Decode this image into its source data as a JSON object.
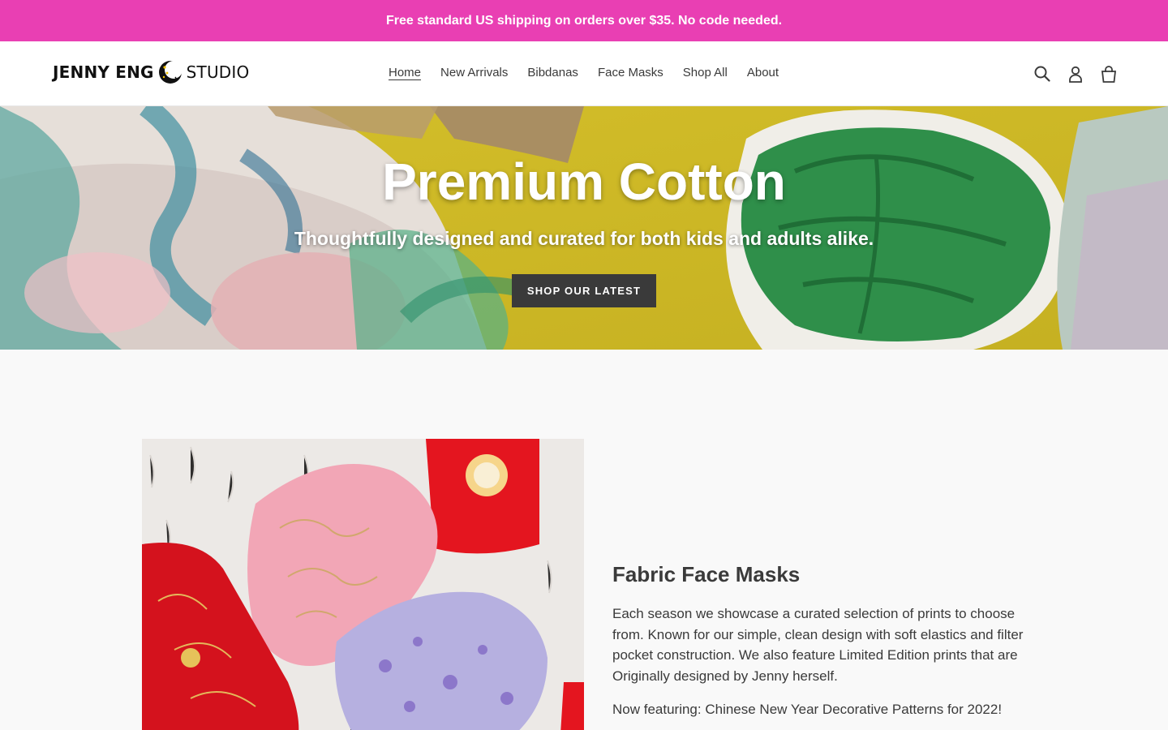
{
  "announcement": {
    "text": "Free standard US shipping on orders over $35. No code needed.",
    "bg_color": "#e93fb3"
  },
  "header": {
    "logo": {
      "part1": "JENNY ENG",
      "part2": "STUDIO",
      "mark_icon": "moon-stars-icon"
    },
    "nav": [
      {
        "label": "Home",
        "active": true
      },
      {
        "label": "New Arrivals"
      },
      {
        "label": "Bibdanas"
      },
      {
        "label": "Face Masks"
      },
      {
        "label": "Shop All"
      },
      {
        "label": "About"
      }
    ],
    "icons": [
      "search-icon",
      "account-icon",
      "cart-icon"
    ]
  },
  "hero": {
    "title": "Premium Cotton",
    "subtitle": "Thoughtfully designed and curated for both kids and adults alike.",
    "button_label": "SHOP OUR LATEST",
    "button_color": "#3a3a3a"
  },
  "feature": {
    "title": "Fabric Face Masks",
    "body": "Each season we showcase a curated selection of prints to choose from. Known for our simple, clean design with soft elastics and filter pocket construction. We also feature Limited Edition prints that are Originally designed by Jenny herself.",
    "note": "Now featuring: Chinese New Year Decorative Patterns for 2022!"
  }
}
